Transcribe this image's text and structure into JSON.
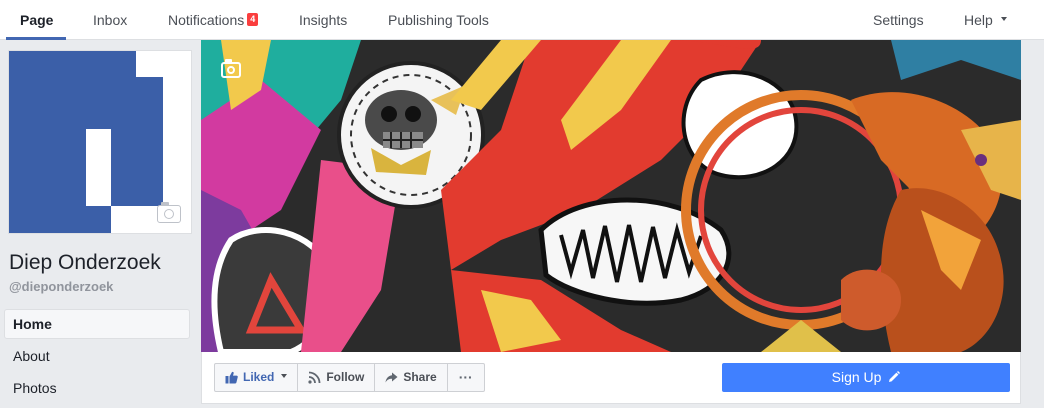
{
  "nav": {
    "page": "Page",
    "inbox": "Inbox",
    "notifications": "Notifications",
    "notifications_count": "4",
    "insights": "Insights",
    "publishing_tools": "Publishing Tools",
    "settings": "Settings",
    "help": "Help"
  },
  "profile": {
    "name": "Diep Onderzoek",
    "handle": "@dieponderzoek",
    "brand_color": "#3b5fa8"
  },
  "sidebar": {
    "items": [
      {
        "label": "Home"
      },
      {
        "label": "About"
      },
      {
        "label": "Photos"
      }
    ]
  },
  "actions": {
    "liked": "Liked",
    "follow": "Follow",
    "share": "Share",
    "more": "···",
    "signup": "Sign Up"
  },
  "colors": {
    "accent": "#4267b2",
    "signup": "#4080ff",
    "badge": "#fa3e3e"
  }
}
